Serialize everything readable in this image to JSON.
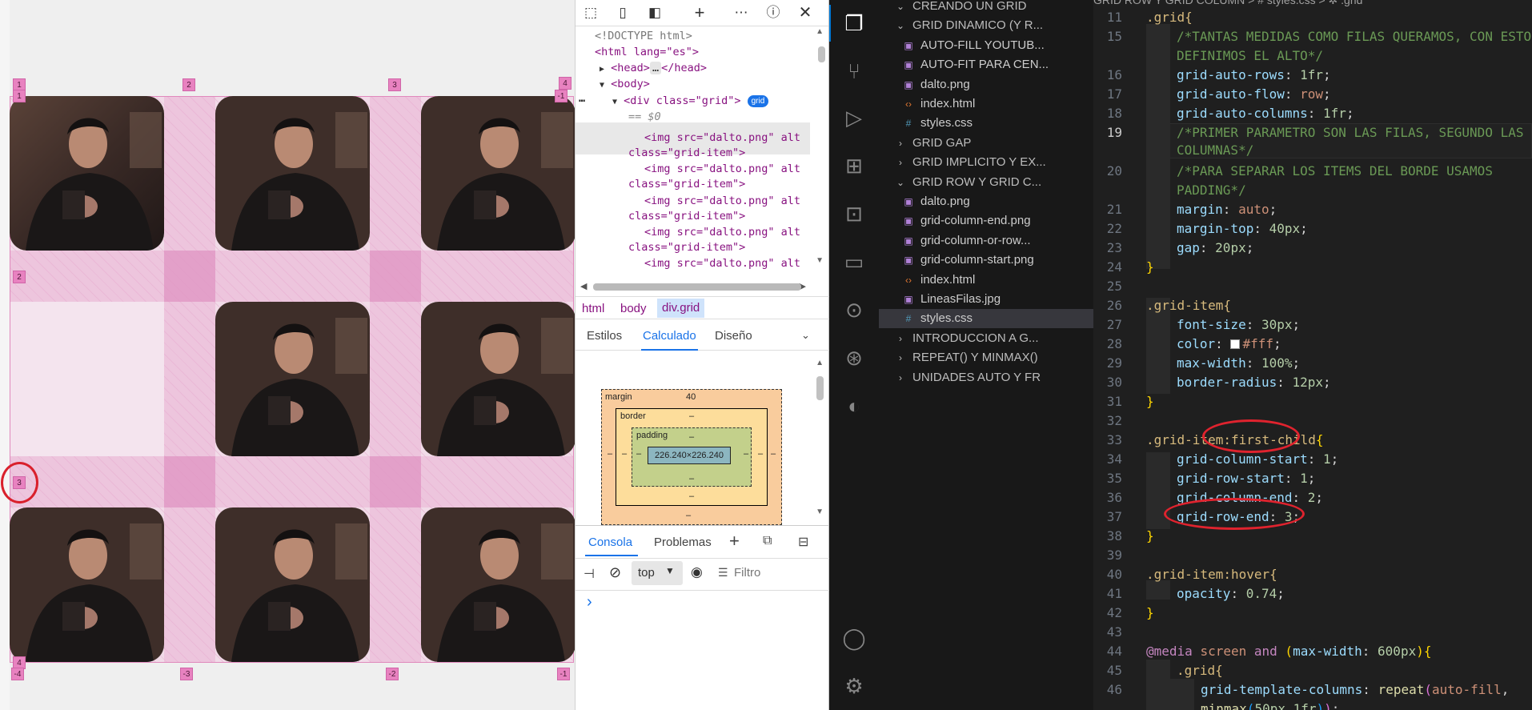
{
  "preview": {
    "column_line_labels_top": [
      "1",
      "2",
      "3",
      "4"
    ],
    "column_line_labels_bottom": [
      "-4",
      "-3",
      "-2",
      "-1"
    ],
    "row_line_labels_left": [
      "1",
      "2",
      "3",
      "4"
    ],
    "end_label_top_right": "-1",
    "image_alt": "dalto.png"
  },
  "devtools": {
    "toolbar_icons": [
      "inspect-icon",
      "device-toggle-icon",
      "dock-panel-icon",
      "add-tab-icon",
      "more-icon",
      "help-icon",
      "close-icon"
    ],
    "dom": {
      "doctype": "<!DOCTYPE html>",
      "html_open": "<html lang=\"es\">",
      "head": "<head>",
      "head_ellipsis": "…",
      "head_close": "</head>",
      "body": "<body>",
      "div_open": "<div class=\"grid\">",
      "grid_pill": "grid",
      "dollar": "== $0",
      "img_line_a": "<img src=\"dalto.png\" alt",
      "img_line_b": "class=\"grid-item\">",
      "img_line_c": "class=\"grid-item\">"
    },
    "breadcrumbs": [
      "html",
      "body",
      "div.grid"
    ],
    "panel_tabs": [
      "Estilos",
      "Calculado",
      "Diseño"
    ],
    "box_model": {
      "margin_label": "margin",
      "margin_top": "40",
      "border_label": "border",
      "padding_label": "padding",
      "dash": "–",
      "content_size": "226.240×226.240"
    },
    "console": {
      "tab_console": "Consola",
      "tab_problems": "Problemas",
      "context": "top",
      "filter_placeholder": "Filtro",
      "prompt": "›"
    }
  },
  "vscode": {
    "breadcrumb": "GRID ROW Y GRID COLUMN > # styles.css > ✲ .grid",
    "explorer": {
      "items": [
        {
          "type": "folder",
          "label": "CREANDO UN GRID",
          "state": "open"
        },
        {
          "type": "folder",
          "label": "GRID DINAMICO (Y R...",
          "state": "open"
        },
        {
          "type": "file",
          "label": "AUTO-FILL YOUTUB...",
          "icon": "image-file-icon"
        },
        {
          "type": "file",
          "label": "AUTO-FIT PARA CEN...",
          "icon": "image-file-icon"
        },
        {
          "type": "file",
          "label": "dalto.png",
          "icon": "image-file-icon"
        },
        {
          "type": "file",
          "label": "index.html",
          "icon": "html-file-icon"
        },
        {
          "type": "file",
          "label": "styles.css",
          "icon": "css-file-icon"
        },
        {
          "type": "folder",
          "label": "GRID GAP",
          "state": "closed"
        },
        {
          "type": "folder",
          "label": "GRID IMPLICITO Y EX...",
          "state": "closed"
        },
        {
          "type": "folder",
          "label": "GRID ROW Y GRID C...",
          "state": "open"
        },
        {
          "type": "file",
          "label": "dalto.png",
          "icon": "image-file-icon"
        },
        {
          "type": "file",
          "label": "grid-column-end.png",
          "icon": "image-file-icon"
        },
        {
          "type": "file",
          "label": "grid-column-or-row...",
          "icon": "image-file-icon"
        },
        {
          "type": "file",
          "label": "grid-column-start.png",
          "icon": "image-file-icon"
        },
        {
          "type": "file",
          "label": "index.html",
          "icon": "html-file-icon"
        },
        {
          "type": "file",
          "label": "LineasFilas.jpg",
          "icon": "image-file-icon"
        },
        {
          "type": "file",
          "label": "styles.css",
          "icon": "css-file-icon",
          "selected": true
        },
        {
          "type": "folder",
          "label": "INTRODUCCION A G...",
          "state": "closed"
        },
        {
          "type": "folder",
          "label": "REPEAT() Y MINMAX()",
          "state": "closed"
        },
        {
          "type": "folder",
          "label": "UNIDADES AUTO Y FR",
          "state": "closed"
        }
      ]
    },
    "line_numbers": [
      "11",
      "15",
      "",
      "16",
      "17",
      "18",
      "19",
      "",
      "20",
      "",
      "21",
      "22",
      "23",
      "24",
      "25",
      "26",
      "27",
      "28",
      "29",
      "30",
      "31",
      "32",
      "33",
      "34",
      "35",
      "36",
      "37",
      "38",
      "39",
      "40",
      "41",
      "42",
      "43",
      "44",
      "45",
      "46",
      ""
    ],
    "code": {
      "l11": ".grid{",
      "l15a": "/*TANTAS MEDIDAS COMO FILAS QUERAMOS, CON ESTO",
      "l15b": "DEFINIMOS EL ALTO*/",
      "l16_prop": "grid-auto-rows",
      "l16_val": "1fr",
      "l17_prop": "grid-auto-flow",
      "l17_val": "row",
      "l18_prop": "grid-auto-columns",
      "l18_val": "1fr",
      "l19a": "/*PRIMER PARAMETRO SON LAS FILAS, SEGUNDO LAS",
      "l19b": "COLUMNAS*/",
      "l20a": "/*PARA SEPARAR LOS ITEMS DEL BORDE USAMOS",
      "l20b": "PADDING*/",
      "l21_prop": "margin",
      "l21_val": "auto",
      "l22_prop": "margin-top",
      "l22_num": "40",
      "l22_unit": "px",
      "l23_prop": "gap",
      "l23_num": "20",
      "l23_unit": "px",
      "l26": ".grid-item{",
      "l27_prop": "font-size",
      "l27_num": "30",
      "l27_unit": "px",
      "l28_prop": "color",
      "l28_val": "#fff",
      "l29_prop": "max-width",
      "l29_num": "100",
      "l29_unit": "%",
      "l30_prop": "border-radius",
      "l30_num": "12",
      "l30_unit": "px",
      "l33_sel": ".grid-item",
      "l33_pseudo": ":first-child",
      "l34_prop": "grid-column-start",
      "l34_num": "1",
      "l35_prop": "grid-row-start",
      "l35_num": "1",
      "l36_prop": "grid-column-end",
      "l36_num": "2",
      "l37_prop": "grid-row-end",
      "l37_num": "3",
      "l40": ".grid-item:hover{",
      "l41_prop": "opacity",
      "l41_num": "0.74",
      "l44_kw": "@media",
      "l44_a": "screen",
      "l44_b": "and",
      "l44_prop": "max-width",
      "l44_num": "600",
      "l44_unit": "px",
      "l45": ".grid{",
      "l46_prop": "grid-template-columns",
      "l46_fn": "repeat",
      "l46_arg": "auto-fill",
      "l47_fn": "minmax",
      "l47_a": "50",
      "l47_b": "1"
    }
  }
}
